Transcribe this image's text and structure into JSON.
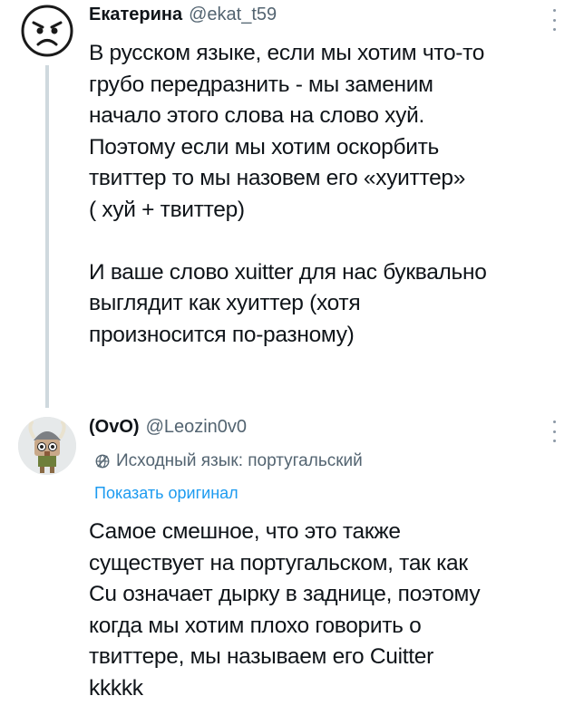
{
  "tweets": [
    {
      "author_name": "Екатерина",
      "handle": "@ekat_t59",
      "avatar": "angry-face-emoji",
      "text": "В русском языке, если мы хотим что-то\nгрубо передразнить - мы заменим\nначало этого слова на слово хуй.\nПоэтому если мы хотим оскорбить\nтвиттер то мы назовем его «хуиттер»\n( хуй + твиттер)\n\nИ ваше слово xuitter для нас буквально\nвыглядит как хуиттер (хотя\nпроизносится по-разному)"
    },
    {
      "author_name": "(OvO)",
      "handle": "@Leozin0v0",
      "avatar": "viking-character",
      "translation_label": "Исходный язык: португальский",
      "show_original": "Показать оригинал",
      "text": "Самое смешное, что это также\nсуществует на португальском, так как\nCu означает дырку в заднице, поэтому\nкогда мы хотим плохо говорить о\nтвиттере, мы называем его Cuitter\nkkkkk"
    }
  ],
  "colors": {
    "text": "#0f1419",
    "secondary": "#536471",
    "link": "#1d9bf0",
    "thread_line": "#cfd9de"
  }
}
